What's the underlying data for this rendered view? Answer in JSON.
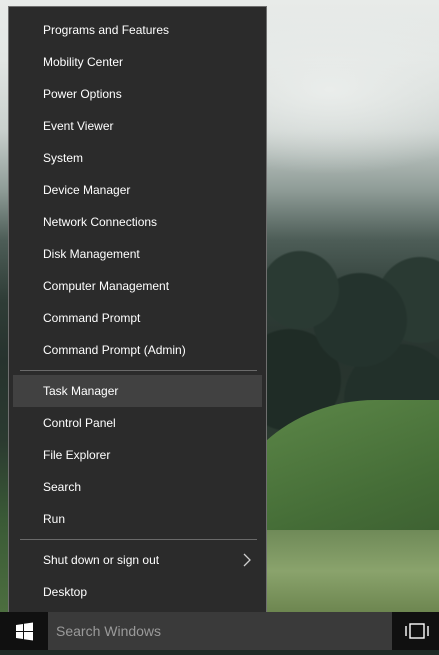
{
  "menu": {
    "items": [
      {
        "label": "Programs and Features"
      },
      {
        "label": "Mobility Center"
      },
      {
        "label": "Power Options"
      },
      {
        "label": "Event Viewer"
      },
      {
        "label": "System"
      },
      {
        "label": "Device Manager"
      },
      {
        "label": "Network Connections"
      },
      {
        "label": "Disk Management"
      },
      {
        "label": "Computer Management"
      },
      {
        "label": "Command Prompt"
      },
      {
        "label": "Command Prompt (Admin)"
      },
      {
        "label": "Task Manager"
      },
      {
        "label": "Control Panel"
      },
      {
        "label": "File Explorer"
      },
      {
        "label": "Search"
      },
      {
        "label": "Run"
      },
      {
        "label": "Shut down or sign out",
        "submenu_icon": "chevron-right-icon"
      },
      {
        "label": "Desktop"
      }
    ],
    "highlighted_item": "Task Manager"
  },
  "taskbar": {
    "start_icon": "windows-logo-icon",
    "search_placeholder": "Search Windows",
    "taskview_icon": "task-view-icon"
  },
  "colors": {
    "menu_bg": "#2b2b2b",
    "menu_hover": "#414141",
    "taskbar_bg": "#101010",
    "search_bg": "#3a3a3a"
  }
}
